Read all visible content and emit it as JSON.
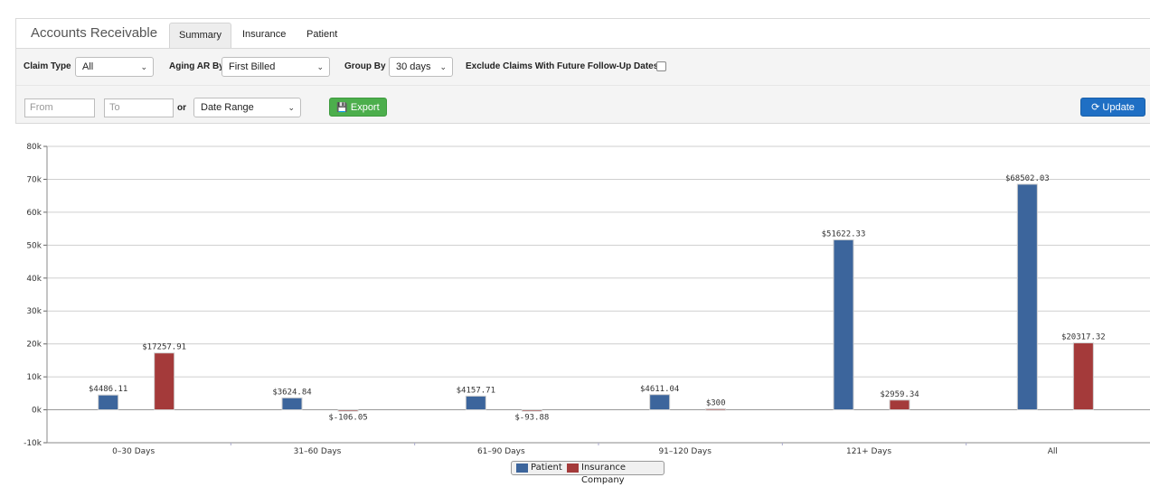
{
  "header": {
    "title": "Accounts Receivable",
    "tabs": [
      {
        "label": "Summary",
        "active": true
      },
      {
        "label": "Insurance",
        "active": false
      },
      {
        "label": "Patient",
        "active": false
      }
    ]
  },
  "filters": {
    "claim_type_label": "Claim Type",
    "claim_type_value": "All",
    "aging_label": "Aging AR By",
    "aging_value": "First Billed",
    "group_by_label": "Group By",
    "group_by_value": "30 days",
    "exclude_label": "Exclude Claims With Future Follow-Up Dates",
    "exclude_checked": false,
    "from_placeholder": "From",
    "to_placeholder": "To",
    "or_label": "or",
    "date_range_value": "Date Range",
    "export_label": "Export",
    "update_label": "Update"
  },
  "colors": {
    "patient": "#3c659c",
    "insurance": "#a43a3a",
    "export": "#4cae4c",
    "update": "#1f6fc4"
  },
  "icons": {
    "export": "floppy-disk-icon",
    "update": "refresh-icon",
    "select": "chevron-down-icon"
  },
  "chart_data": {
    "type": "bar",
    "categories": [
      "0–30 Days",
      "31–60 Days",
      "61–90 Days",
      "91–120 Days",
      "121+ Days",
      "All"
    ],
    "series": [
      {
        "name": "Patient",
        "values": [
          4486.11,
          3624.84,
          4157.71,
          4611.04,
          51622.33,
          68502.03
        ],
        "labels": [
          "$4486.11",
          "$3624.84",
          "$4157.71",
          "$4611.04",
          "$51622.33",
          "$68502.03"
        ]
      },
      {
        "name": "Insurance Company",
        "values": [
          17257.91,
          -106.05,
          -93.88,
          300,
          2959.34,
          20317.32
        ],
        "labels": [
          "$17257.91",
          "$-106.05",
          "$-93.88",
          "$300",
          "$2959.34",
          "$20317.32"
        ]
      }
    ],
    "ylim": [
      -10000,
      80000
    ],
    "yticks": [
      "-10k",
      "0k",
      "10k",
      "20k",
      "30k",
      "40k",
      "50k",
      "60k",
      "70k",
      "80k"
    ],
    "grid": true,
    "legend": "bottom-center"
  }
}
